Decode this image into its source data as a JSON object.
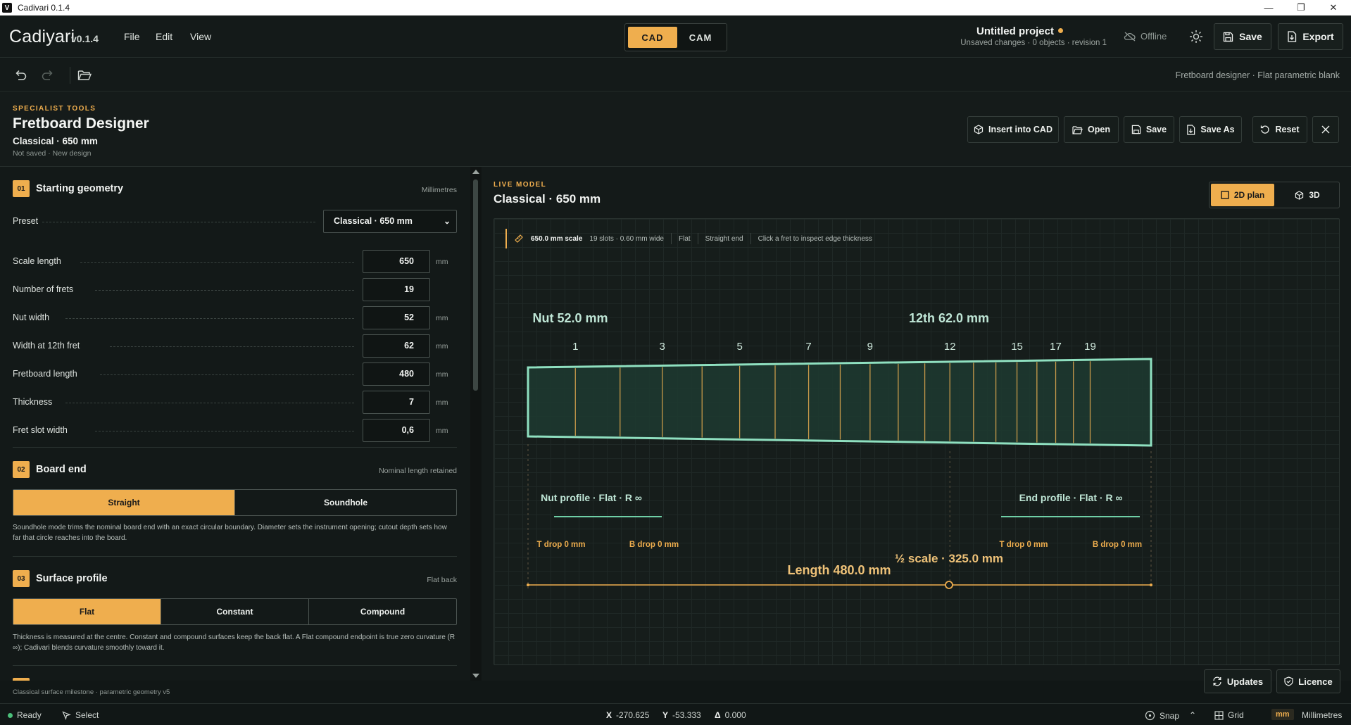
{
  "window": {
    "title": "Cadivari 0.1.4",
    "app_glyph": "V"
  },
  "header": {
    "brand": "Cadiyari",
    "version": "v0.1.4",
    "menu": [
      "File",
      "Edit",
      "View"
    ],
    "modes": [
      "CAD",
      "CAM"
    ],
    "active_mode": "CAD",
    "project_title": "Untitled project",
    "project_sub": "Unsaved changes · 0 objects · revision 1",
    "offline": "Offline",
    "save": "Save",
    "export": "Export"
  },
  "toolbar": {
    "right_text": "Fretboard designer · Flat parametric blank"
  },
  "tool": {
    "kicker": "SPECIALIST TOOLS",
    "title": "Fretboard Designer",
    "subtitle": "Classical · 650 mm",
    "meta": "Not saved · New design",
    "actions": [
      "Insert into CAD",
      "Open",
      "Save",
      "Save As",
      "Reset"
    ]
  },
  "sections": {
    "s1": {
      "num": "01",
      "title": "Starting geometry",
      "note": "Millimetres",
      "preset_label": "Preset",
      "preset_value": "Classical · 650 mm",
      "rows": [
        {
          "label": "Scale length",
          "value": "650",
          "unit": "mm"
        },
        {
          "label": "Number of frets",
          "value": "19",
          "unit": ""
        },
        {
          "label": "Nut width",
          "value": "52",
          "unit": "mm"
        },
        {
          "label": "Width at 12th fret",
          "value": "62",
          "unit": "mm"
        },
        {
          "label": "Fretboard length",
          "value": "480",
          "unit": "mm"
        },
        {
          "label": "Thickness",
          "value": "7",
          "unit": "mm"
        },
        {
          "label": "Fret slot width",
          "value": "0,6",
          "unit": "mm"
        }
      ]
    },
    "s2": {
      "num": "02",
      "title": "Board end",
      "note": "Nominal length retained",
      "options": [
        "Straight",
        "Soundhole"
      ],
      "help": "Soundhole mode trims the nominal board end with an exact circular boundary. Diameter sets the instrument opening; cutout depth sets how far that circle reaches into the board."
    },
    "s3": {
      "num": "03",
      "title": "Surface profile",
      "note": "Flat back",
      "options": [
        "Flat",
        "Constant",
        "Compound"
      ],
      "help": "Thickness is measured at the centre. Constant and compound surfaces keep the back flat. A Flat compound endpoint is true zero curvature (R ∞); Cadivari blends curvature smoothly toward it."
    },
    "footer": "Classical surface milestone · parametric geometry v5"
  },
  "model": {
    "kicker": "LIVE MODEL",
    "title": "Classical · 650 mm",
    "views": [
      "2D plan",
      "3D"
    ],
    "info": {
      "scale": "650.0 mm scale",
      "slots": "19 slots · 0.60 mm wide",
      "flat": "Flat",
      "end": "Straight end",
      "hint": "Click a fret to inspect edge thickness"
    },
    "labels": {
      "nut": "Nut 52.0 mm",
      "twelfth": "12th 62.0 mm",
      "fret_numbers": [
        "1",
        "3",
        "5",
        "7",
        "9",
        "12",
        "15",
        "17",
        "19"
      ],
      "nut_profile": "Nut profile · Flat · R ∞",
      "end_profile": "End profile · Flat · R ∞",
      "t_drop_left": "T drop 0 mm",
      "b_drop_left": "B drop 0 mm",
      "t_drop_right": "T drop 0 mm",
      "b_drop_right": "B drop 0 mm",
      "length": "Length 480.0 mm",
      "half_scale": "½ scale · 325.0 mm"
    }
  },
  "corner": {
    "updates": "Updates",
    "licence": "Licence"
  },
  "status": {
    "ready": "Ready",
    "select": "Select",
    "x_label": "X",
    "x_value": "-270.625",
    "y_label": "Y",
    "y_value": "-53.333",
    "d_label": "Δ",
    "d_value": "0.000",
    "snap": "Snap",
    "grid": "Grid",
    "unit_badge": "mm",
    "unit_name": "Millimetres"
  },
  "colors": {
    "accent": "#efae4e",
    "board_edge": "#8fe0c0",
    "board_fill": "#1d3a30",
    "fret": "#c79a4a"
  }
}
